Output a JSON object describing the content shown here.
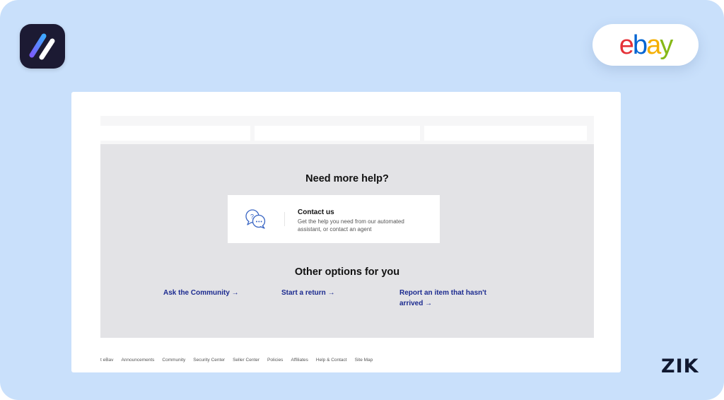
{
  "branding": {
    "ebay_letters": [
      {
        "char": "e",
        "color": "#e53238"
      },
      {
        "char": "b",
        "color": "#0064d2"
      },
      {
        "char": "a",
        "color": "#f5af02"
      },
      {
        "char": "y",
        "color": "#86b817"
      }
    ],
    "zik_text": "ZIK",
    "app_logo_colors": {
      "background": "#1c1a33",
      "stroke_gradient": [
        "#7b5cff",
        "#3ea8ff"
      ],
      "stroke_white": "#ffffff"
    }
  },
  "help": {
    "title": "Need more help?",
    "contact": {
      "title": "Contact us",
      "description": "Get the help you need from our automated assistant, or contact an agent",
      "icon": "chat-bubbles-icon"
    },
    "other_title": "Other options for you",
    "options": [
      {
        "label": "Ask the Community →"
      },
      {
        "label": "Start a return →"
      },
      {
        "label": "Report an item that hasn't arrived →"
      }
    ],
    "link_color": "#1b2a8f"
  },
  "footer": {
    "links": [
      "t eBav",
      "Announcements",
      "Community",
      "Security Center",
      "Seller Center",
      "Policies",
      "Affiliates",
      "Help & Contact",
      "Site Map"
    ]
  }
}
